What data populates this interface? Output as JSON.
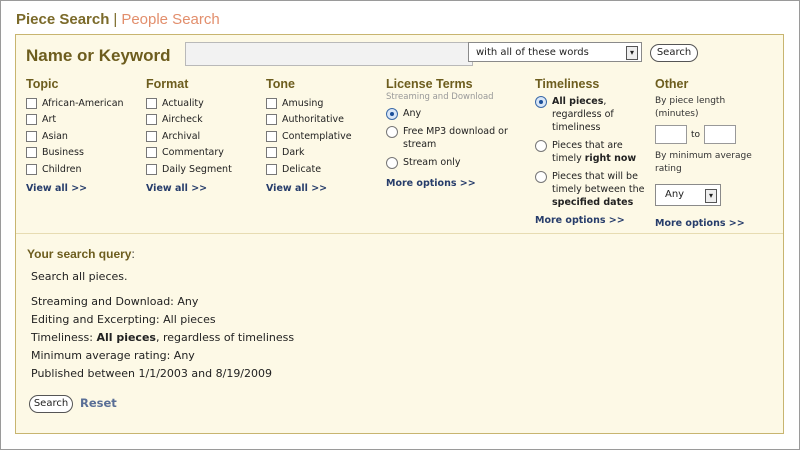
{
  "tabs": {
    "active": "Piece Search",
    "separator": "|",
    "inactive": "People Search"
  },
  "keyword": {
    "label": "Name or Keyword",
    "input_value": "",
    "mode_select": "with all of these words",
    "search_button": "Search"
  },
  "facets": {
    "topic": {
      "heading": "Topic",
      "options": [
        "African-American",
        "Art",
        "Asian",
        "Business",
        "Children"
      ],
      "view_all": "View all >>"
    },
    "format": {
      "heading": "Format",
      "options": [
        "Actuality",
        "Aircheck",
        "Archival",
        "Commentary",
        "Daily Segment"
      ],
      "view_all": "View all >>"
    },
    "tone": {
      "heading": "Tone",
      "options": [
        "Amusing",
        "Authoritative",
        "Contemplative",
        "Dark",
        "Delicate"
      ],
      "view_all": "View all >>"
    },
    "license": {
      "heading": "License Terms",
      "subheading": "Streaming and Download",
      "options": [
        "Any",
        "Free MP3 download or stream",
        "Stream only"
      ],
      "selected": "Any",
      "more": "More options >>"
    },
    "timeliness": {
      "heading": "Timeliness",
      "option1_bold": "All pieces",
      "option1_rest": ", regardless of timeliness",
      "option2_pre": "Pieces that are timely ",
      "option2_bold": "right now",
      "option3_pre": "Pieces that will be timely between the ",
      "option3_bold": "specified dates",
      "more": "More options >>"
    },
    "other": {
      "heading": "Other",
      "length_label": "By piece length (minutes)",
      "to": "to",
      "rating_label": "By minimum average rating",
      "rating_value": "Any",
      "more": "More options >>"
    }
  },
  "query": {
    "heading": "Your search query",
    "colon": ":",
    "summary": "Search all pieces.",
    "lines": {
      "streaming": "Streaming and Download: Any",
      "editing": "Editing and Excerpting: All pieces",
      "timeliness_label": "Timeliness: ",
      "timeliness_bold": "All pieces",
      "timeliness_rest": ", regardless of timeliness",
      "rating": "Minimum average rating: Any",
      "published": "Published between 1/1/2003 and 8/19/2009"
    },
    "search_button": "Search",
    "reset": "Reset"
  }
}
